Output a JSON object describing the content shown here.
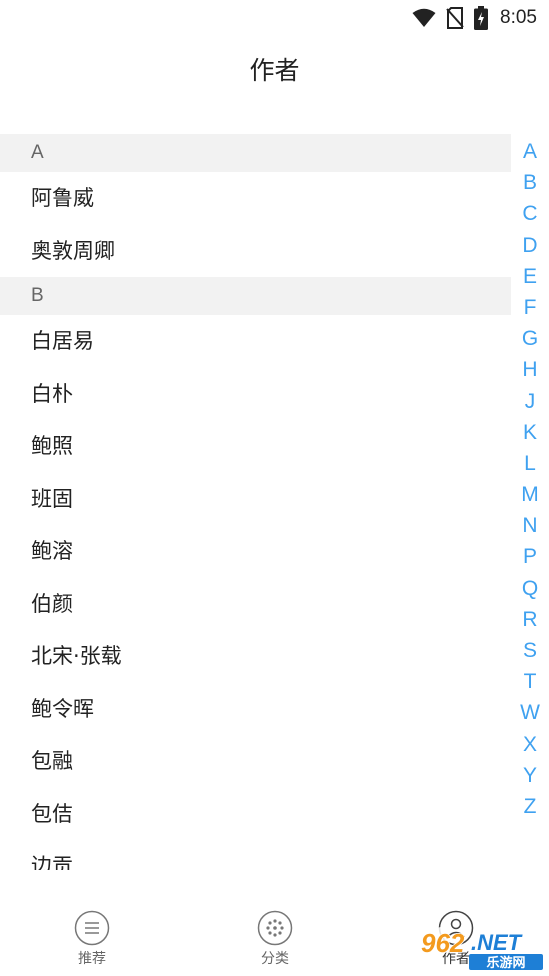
{
  "status_bar": {
    "time": "8:05",
    "icons": [
      "wifi-icon",
      "no-sim-icon",
      "battery-charging-icon"
    ]
  },
  "header": {
    "title": "作者"
  },
  "list": {
    "sections": [
      {
        "letter": "A",
        "items": [
          "阿鲁威",
          "奥敦周卿"
        ]
      },
      {
        "letter": "B",
        "items": [
          "白居易",
          "白朴",
          "鲍照",
          "班固",
          "鲍溶",
          "伯颜",
          "北宋·张载",
          "鲍令晖",
          "包融",
          "包佶",
          "边贡"
        ]
      }
    ]
  },
  "index_bar": {
    "letters": [
      "A",
      "B",
      "C",
      "D",
      "E",
      "F",
      "G",
      "H",
      "J",
      "K",
      "L",
      "M",
      "N",
      "P",
      "Q",
      "R",
      "S",
      "T",
      "W",
      "X",
      "Y",
      "Z"
    ]
  },
  "bottom_nav": {
    "tabs": [
      {
        "label": "推荐",
        "icon": "list-circle-icon"
      },
      {
        "label": "分类",
        "icon": "dots-circle-icon"
      },
      {
        "label": "作者",
        "icon": "person-circle-icon"
      }
    ]
  },
  "watermark": {
    "brand": "962.NET",
    "subtitle": "乐游网"
  },
  "colors": {
    "index_accent": "#3fa1f0",
    "section_header_bg": "#f2f2f2",
    "watermark_orange": "#f39a1e",
    "watermark_blue": "#1e7fd6"
  }
}
